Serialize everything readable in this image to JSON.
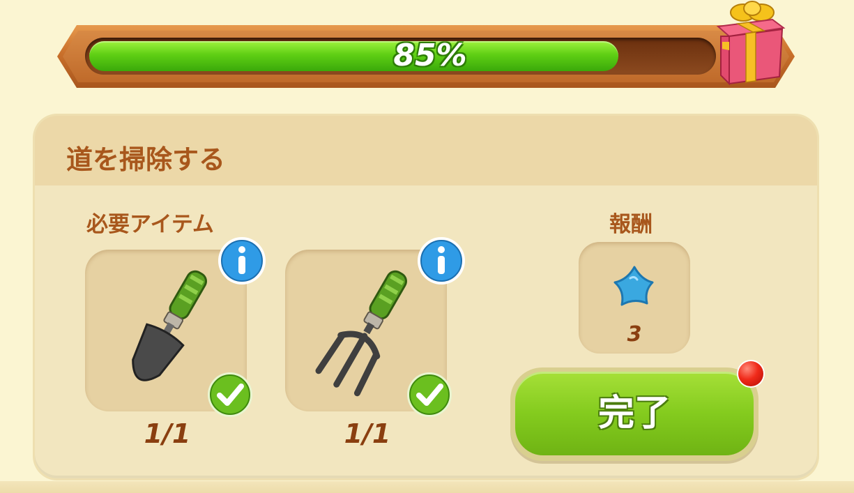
{
  "progress": {
    "percent_label": "85%",
    "fraction": 0.85
  },
  "task": {
    "title": "道を掃除する",
    "required_label": "必要アイテム",
    "reward_label": "報酬",
    "items": [
      {
        "icon": "trowel-icon",
        "count": "1/1",
        "completed": true
      },
      {
        "icon": "garden-fork-icon",
        "count": "1/1",
        "completed": true
      }
    ],
    "reward": {
      "icon": "blue-star-icon",
      "count": "3"
    },
    "complete_label": "完了"
  },
  "colors": {
    "accent_text": "#a8571c",
    "progress_fill": "#5fcf14",
    "button_green": "#84cb1e",
    "notification": "#f02a1a"
  }
}
